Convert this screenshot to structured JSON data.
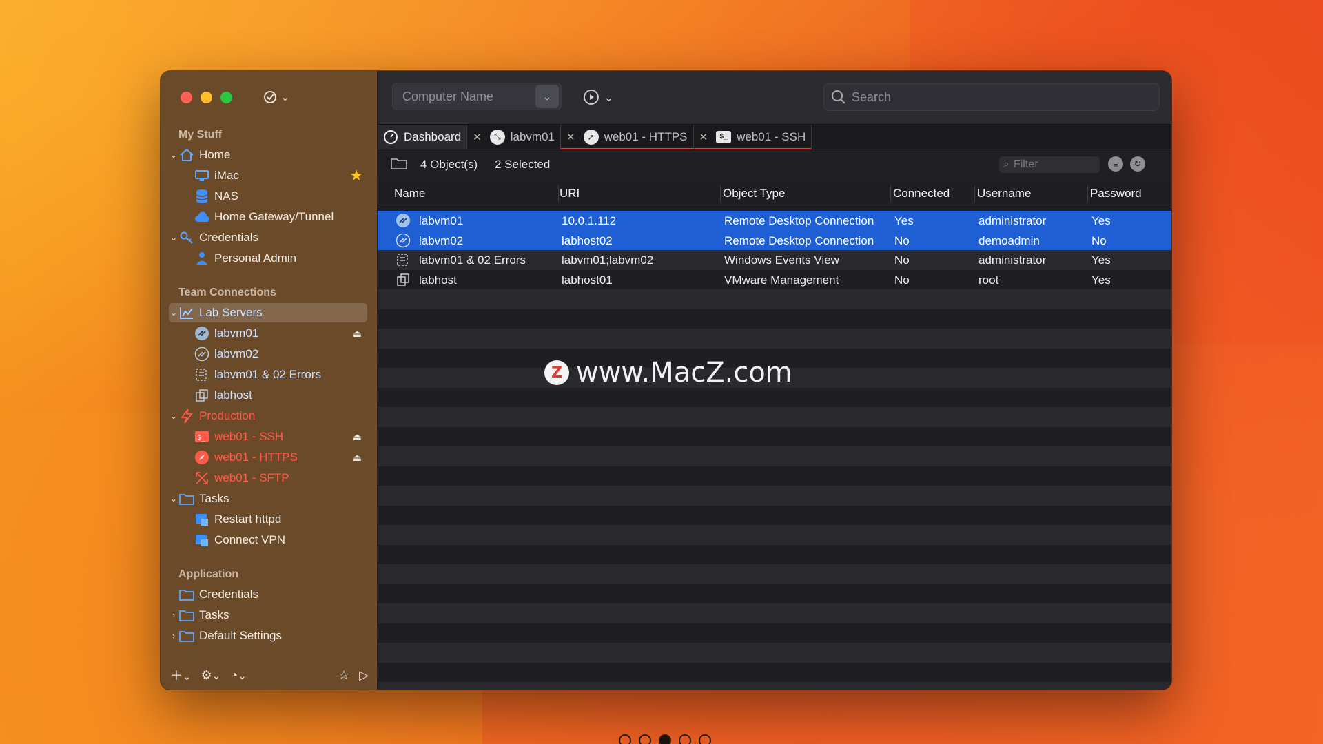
{
  "window": {
    "top_menu_icon": "compass-check-icon"
  },
  "sidebar": {
    "sections": {
      "my_stuff": "My Stuff",
      "team_connections": "Team Connections",
      "application": "Application"
    },
    "items": {
      "home": "Home",
      "imac": "iMac",
      "nas": "NAS",
      "home_gateway": "Home Gateway/Tunnel",
      "credentials": "Credentials",
      "personal_admin": "Personal Admin",
      "lab_servers": "Lab Servers",
      "labvm01": "labvm01",
      "labvm02": "labvm02",
      "labvm_errors": "labvm01 & 02 Errors",
      "labhost": "labhost",
      "production": "Production",
      "web01_ssh": "web01 - SSH",
      "web01_https": "web01 - HTTPS",
      "web01_sftp": "web01 - SFTP",
      "tasks": "Tasks",
      "restart_httpd": "Restart httpd",
      "connect_vpn": "Connect VPN",
      "app_credentials": "Credentials",
      "app_tasks": "Tasks",
      "default_settings": "Default Settings"
    }
  },
  "toolbar": {
    "computer_name_placeholder": "Computer Name",
    "search_placeholder": "Search"
  },
  "tabs": [
    {
      "label": "Dashboard"
    },
    {
      "label": "labvm01"
    },
    {
      "label": "web01 - HTTPS"
    },
    {
      "label": "web01 - SSH"
    }
  ],
  "infobar": {
    "count": "4 Object(s)",
    "selected": "2 Selected",
    "filter_placeholder": "Filter"
  },
  "table": {
    "columns": [
      "Name",
      "URI",
      "Object Type",
      "Connected",
      "Username",
      "Password"
    ],
    "rows": [
      {
        "name": "labvm01",
        "uri": "10.0.1.112",
        "type": "Remote Desktop Connection",
        "connected": "Yes",
        "username": "administrator",
        "password": "Yes",
        "selected": true
      },
      {
        "name": "labvm02",
        "uri": "labhost02",
        "type": "Remote Desktop Connection",
        "connected": "No",
        "username": "demoadmin",
        "password": "No",
        "selected": true
      },
      {
        "name": "labvm01 & 02 Errors",
        "uri": "labvm01;labvm02",
        "type": "Windows Events View",
        "connected": "No",
        "username": "administrator",
        "password": "Yes",
        "selected": false
      },
      {
        "name": "labhost",
        "uri": "labhost01",
        "type": "VMware Management",
        "connected": "No",
        "username": "root",
        "password": "Yes",
        "selected": false
      }
    ]
  },
  "watermark": {
    "logo_letter": "Z",
    "text": "www.MacZ.com"
  },
  "colors": {
    "selection": "#1e5fd6",
    "sidebar_bg": "#6b4a2a",
    "production_red": "#ff5a4a",
    "star": "#ffc41a"
  }
}
